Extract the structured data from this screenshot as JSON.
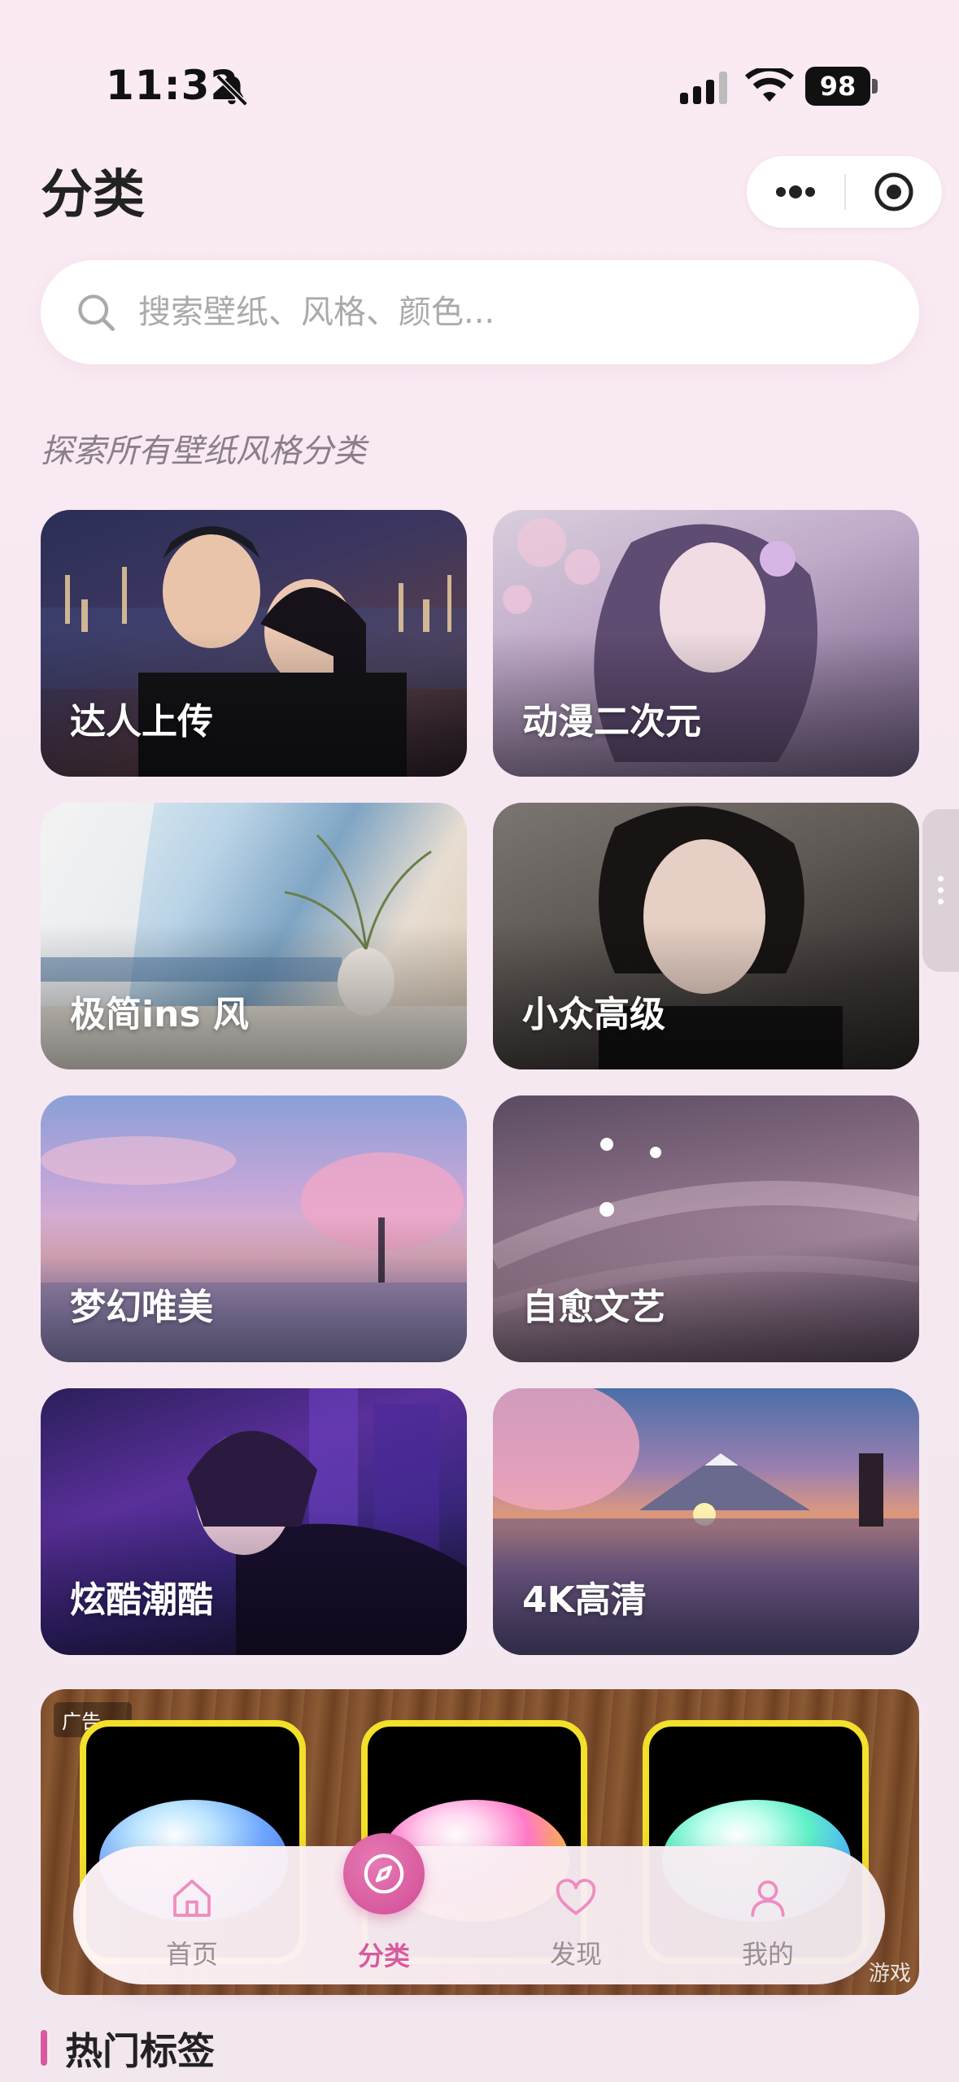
{
  "status_bar": {
    "time": "11:32",
    "battery": "98"
  },
  "header": {
    "title": "分类"
  },
  "search": {
    "placeholder": "搜索壁纸、风格、颜色..."
  },
  "subtitle": "探索所有壁纸风格分类",
  "categories": [
    {
      "label": "达人上传"
    },
    {
      "label": "动漫二次元"
    },
    {
      "label": "极简ins 风"
    },
    {
      "label": "小众高级"
    },
    {
      "label": "梦幻唯美"
    },
    {
      "label": "自愈文艺"
    },
    {
      "label": "炫酷潮酷"
    },
    {
      "label": "4K高清"
    }
  ],
  "ad": {
    "tag": "广告",
    "footer": "游戏"
  },
  "nav": {
    "items": [
      {
        "label": "首页"
      },
      {
        "label": "分类"
      },
      {
        "label": "发现"
      },
      {
        "label": "我的"
      }
    ],
    "active": "分类"
  },
  "section": {
    "title": "热门标签"
  },
  "colors": {
    "accent": "#d85a9e",
    "ad_border": "#f2e02a"
  }
}
